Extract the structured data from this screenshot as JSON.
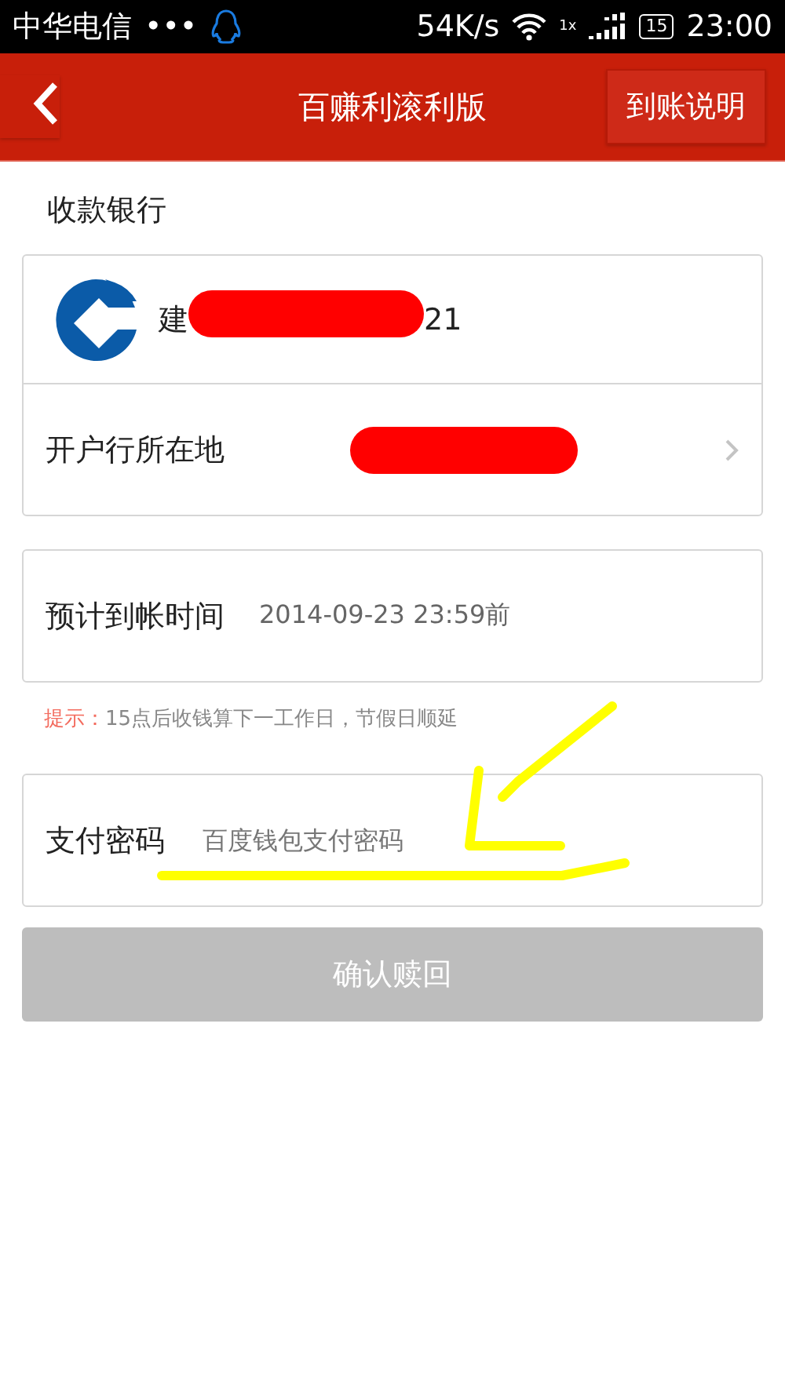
{
  "status_bar": {
    "carrier": "中华电信",
    "dots": "•••",
    "speed": "54K/s",
    "network": "1x",
    "battery": "15",
    "time": "23:00"
  },
  "header": {
    "title": "百赚利滚利版",
    "action": "到账说明"
  },
  "receiving_bank": {
    "heading": "收款银行",
    "bank_name_start": "建",
    "bank_name_end": "21",
    "location_label": "开户行所在地"
  },
  "arrival": {
    "label": "预计到帐时间",
    "value": "2014-09-23 23:59前"
  },
  "hint": {
    "prefix": "提示：",
    "text": "15点后收钱算下一工作日，节假日顺延"
  },
  "password": {
    "label": "支付密码",
    "placeholder": "百度钱包支付密码"
  },
  "confirm_button": {
    "label": "确认赎回",
    "disabled": true
  }
}
